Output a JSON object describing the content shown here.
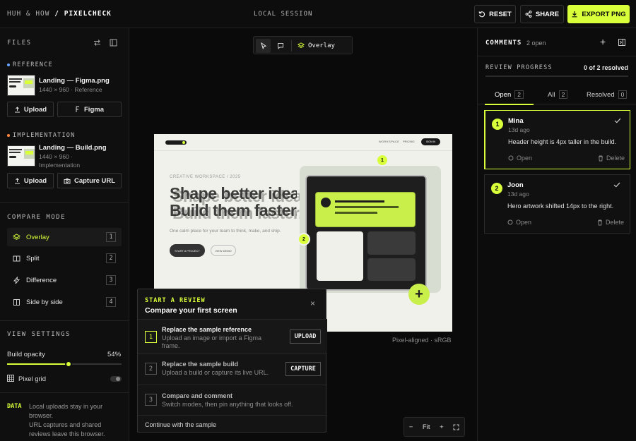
{
  "topbar": {
    "brand_prefix": "HUH & HOW",
    "brand_sep": "/",
    "brand_app": "PIXELCHECK",
    "session_label": "LOCAL SESSION",
    "reset_label": "RESET",
    "share_label": "SHARE",
    "export_label": "EXPORT PNG"
  },
  "files": {
    "title": "FILES",
    "reference": {
      "title": "REFERENCE",
      "dot_color": "#6aa6ff",
      "name": "Landing — Figma.png",
      "meta": "1440 × 960 · Reference",
      "upload_label": "Upload",
      "figma_label": "Figma"
    },
    "implementation": {
      "title": "IMPLEMENTATION",
      "dot_color": "#ff8a3d",
      "name": "Landing — Build.png",
      "meta1": "1440 × 960 ·",
      "meta2": "Implementation",
      "upload_label": "Upload",
      "capture_label": "Capture URL"
    }
  },
  "compare": {
    "title": "COMPARE MODE",
    "modes": [
      {
        "label": "Overlay",
        "key": "1"
      },
      {
        "label": "Split",
        "key": "2"
      },
      {
        "label": "Difference",
        "key": "3"
      },
      {
        "label": "Side by side",
        "key": "4"
      }
    ]
  },
  "view": {
    "title": "VIEW SETTINGS",
    "opacity_label": "Build opacity",
    "opacity_value": "54%",
    "opacity_fraction": 0.54,
    "grid_label": "Pixel grid"
  },
  "data_note": {
    "tag": "DATA",
    "line1": "Local uploads stay in your",
    "line2": "browser.",
    "line3": "URL captures and shared",
    "line4": "reviews leave this browser."
  },
  "canvas": {
    "overlay_label": "Overlay",
    "caption": "Pixel-aligned · sRGB",
    "zoom_label": "Fit",
    "mock": {
      "eyebrow": "CREATIVE WORKSPACE / 2025",
      "headline1": "Shape better ideas.",
      "headline2": "Build them faster.",
      "body": "One calm place for your team to think, make, and ship.",
      "cta_primary": "START A PROJECT",
      "cta_secondary": "VIEW DEMO",
      "nav_left": "WORKSPACE",
      "nav_mid": "PRICING",
      "nav_btn": "SIGN IN",
      "pin1": "1",
      "pin2": "2"
    }
  },
  "onboarding": {
    "eyebrow": "START A REVIEW",
    "title": "Compare your first screen",
    "steps": [
      {
        "num": "1",
        "title": "Replace the sample reference",
        "desc": "Upload an image or import a Figma frame.",
        "action": "UPLOAD"
      },
      {
        "num": "2",
        "title": "Replace the sample build",
        "desc": "Upload a build or capture its live URL.",
        "action": "CAPTURE"
      },
      {
        "num": "3",
        "title": "Compare and comment",
        "desc": "Switch modes, then pin anything that looks off.",
        "action": ""
      }
    ],
    "continue_label": "Continue with the sample"
  },
  "comments": {
    "title": "COMMENTS",
    "open_count": "2 open",
    "progress_label": "REVIEW PROGRESS",
    "progress_text": "0 of 2 resolved",
    "progress_fraction": 0,
    "tabs": [
      {
        "label": "Open",
        "count": "2"
      },
      {
        "label": "All",
        "count": "2"
      },
      {
        "label": "Resolved",
        "count": "0"
      }
    ],
    "items": [
      {
        "num": "1",
        "author": "Mina",
        "ago": "13d ago",
        "text": "Header height is 4px taller in the build.",
        "open_label": "Open",
        "delete_label": "Delete"
      },
      {
        "num": "2",
        "author": "Joon",
        "ago": "13d ago",
        "text": "Hero artwork shifted 14px to the right.",
        "open_label": "Open",
        "delete_label": "Delete"
      }
    ]
  },
  "colors": {
    "accent": "#d8ff3a",
    "panel": "#0f0f0f",
    "border": "#222222"
  }
}
